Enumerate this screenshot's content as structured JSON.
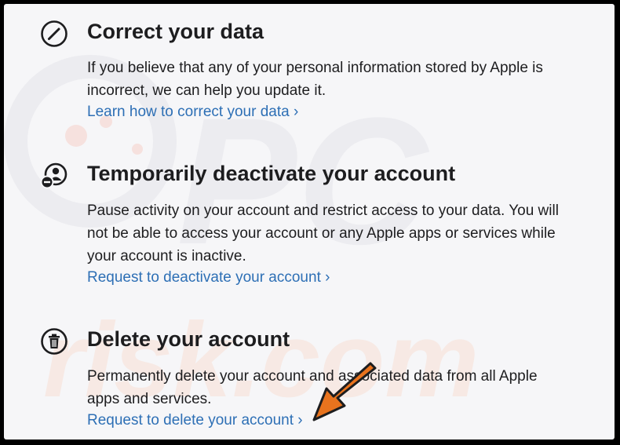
{
  "sections": [
    {
      "icon": "pencil-icon",
      "title": "Correct your data",
      "body": [
        "If you believe that any of your personal information stored by Apple is",
        "incorrect, we can help you update it."
      ],
      "link": "Learn how to correct your data ›"
    },
    {
      "icon": "deactivate-account-icon",
      "title": "Temporarily deactivate your account",
      "body": [
        "Pause activity on your account and restrict access to your data. You will",
        "not be able to access your account or any Apple apps or services while",
        "your account is inactive."
      ],
      "link": "Request to deactivate your account ›"
    },
    {
      "icon": "trash-icon",
      "title": "Delete your account",
      "body": [
        "Permanently delete your account and associated data from all Apple",
        "apps and services."
      ],
      "link": "Request to delete your account ›"
    }
  ],
  "watermark": {
    "line1": "PC",
    "line2": "risk.com"
  },
  "colors": {
    "link": "#2d6fb5",
    "text": "#1d1d1f",
    "arrow": "#e8731e",
    "background": "#f6f6f8"
  }
}
